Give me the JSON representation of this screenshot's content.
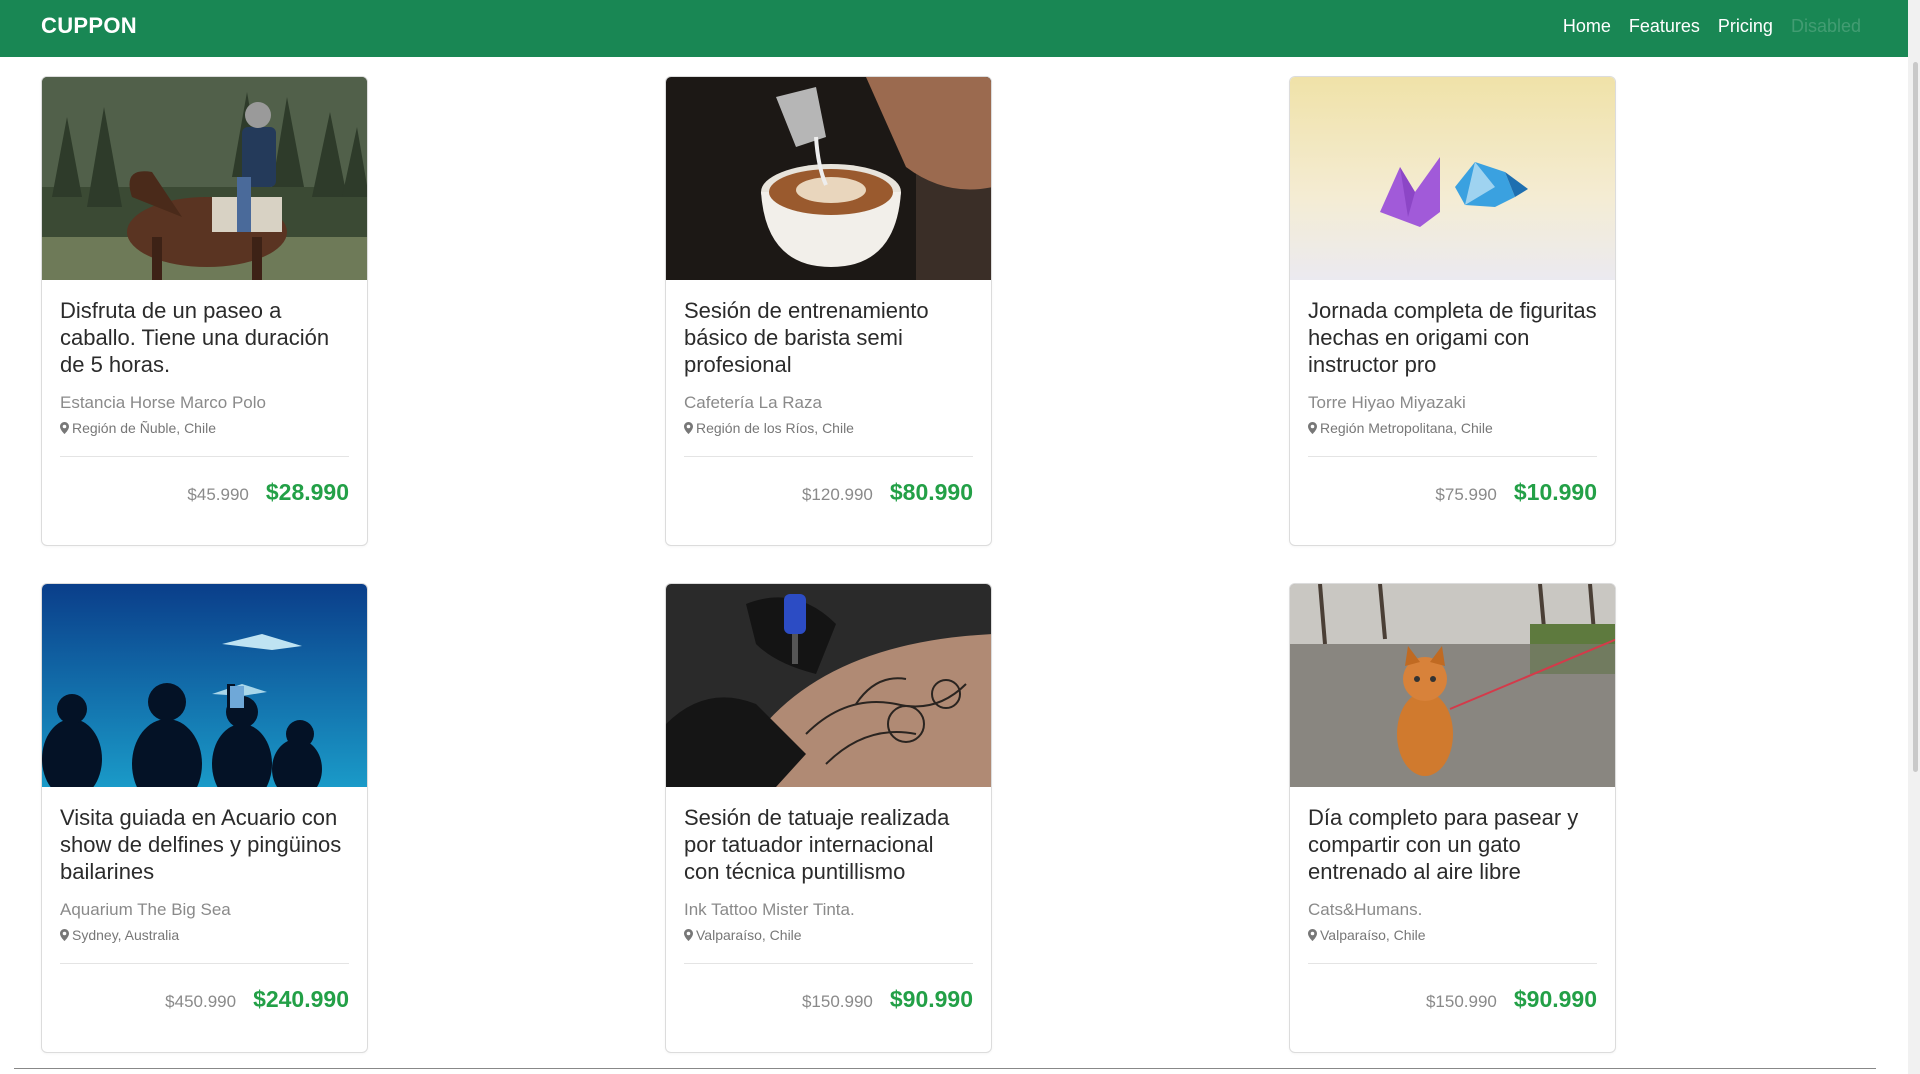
{
  "navbar": {
    "brand": "CUPPON",
    "links": [
      "Home",
      "Features",
      "Pricing",
      "Disabled"
    ]
  },
  "colors": {
    "navbar": "#198754",
    "price_accent": "#23a047"
  },
  "deals": [
    {
      "title": "Disfruta de un paseo a caballo. Tiene una duración de 5 horas.",
      "vendor": "Estancia Horse Marco Polo",
      "location": "Región de Ñuble, Chile",
      "old_price": "$45.990",
      "new_price": "$28.990",
      "image": "horseback-rider-photo"
    },
    {
      "title": "Sesión de entrenamiento básico de barista semi profesional",
      "vendor": "Cafetería La Raza",
      "location": "Región de los Ríos, Chile",
      "old_price": "$120.990",
      "new_price": "$80.990",
      "image": "latte-art-photo"
    },
    {
      "title": "Jornada completa de figuritas hechas en origami con instructor pro",
      "vendor": "Torre Hiyao Miyazaki",
      "location": "Región Metropolitana, Chile",
      "old_price": "$75.990",
      "new_price": "$10.990",
      "image": "origami-birds-photo"
    },
    {
      "title": "Visita guiada en Acuario con show de delfines y pingüinos bailarines",
      "vendor": "Aquarium The Big Sea",
      "location": "Sydney, Australia",
      "old_price": "$450.990",
      "new_price": "$240.990",
      "image": "aquarium-photo"
    },
    {
      "title": "Sesión de tatuaje realizada por tatuador internacional con técnica puntillismo",
      "vendor": "Ink Tattoo Mister Tinta.",
      "location": "Valparaíso, Chile",
      "old_price": "$150.990",
      "new_price": "$90.990",
      "image": "tattoo-photo"
    },
    {
      "title": "Día completo para pasear y compartir con un gato entrenado al aire libre",
      "vendor": "Cats&Humans.",
      "location": "Valparaíso, Chile",
      "old_price": "$150.990",
      "new_price": "$90.990",
      "image": "cat-on-leash-photo"
    }
  ]
}
